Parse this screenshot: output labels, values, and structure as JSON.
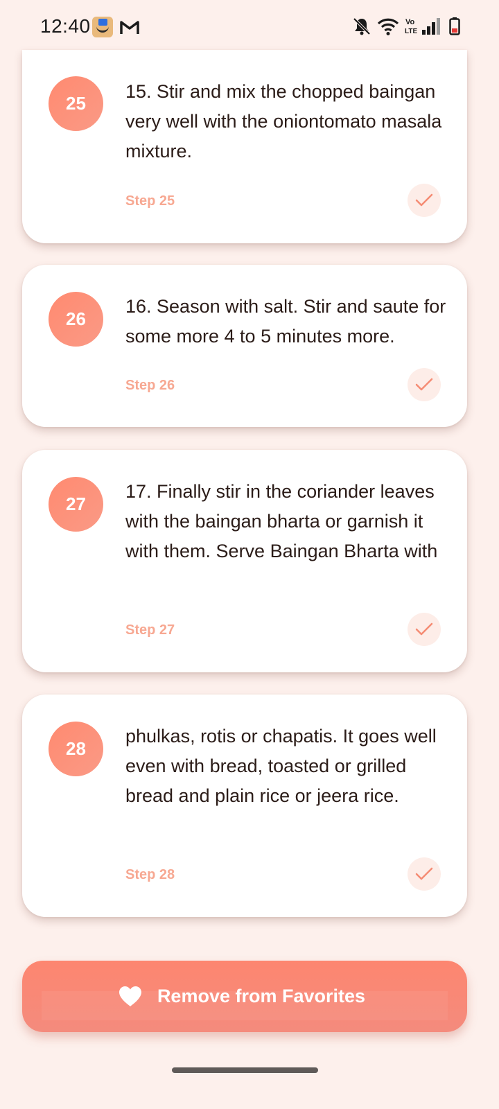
{
  "status_bar": {
    "time": "12:40",
    "icons": [
      "amazon-icon",
      "gmail-icon",
      "bell-off-icon",
      "wifi-icon",
      "volte-icon",
      "signal-icon",
      "battery-icon"
    ],
    "volte_text": "Vo LTE"
  },
  "steps": [
    {
      "number": "25",
      "text": "15. Stir and mix the chopped baingan very well with the oniontomato masala mixture.",
      "label": "Step 25"
    },
    {
      "number": "26",
      "text": "16. Season with salt. Stir and saute for some more 4 to 5 minutes more.",
      "label": "Step 26"
    },
    {
      "number": "27",
      "text": "17. Finally stir in the coriander leaves with the baingan bharta or garnish it with them. Serve Baingan Bharta with",
      "label": "Step 27"
    },
    {
      "number": "28",
      "text": "phulkas, rotis or chapatis. It goes well even with bread, toasted or grilled bread and plain rice or jeera rice.",
      "label": "Step 28"
    }
  ],
  "favorites_button": {
    "label": "Remove from Favorites",
    "icon": "heart-icon"
  },
  "colors": {
    "background": "#FDF0EC",
    "accent": "#FF8A70",
    "step_label": "#F7A892",
    "check_bg": "#FDEDE8"
  }
}
